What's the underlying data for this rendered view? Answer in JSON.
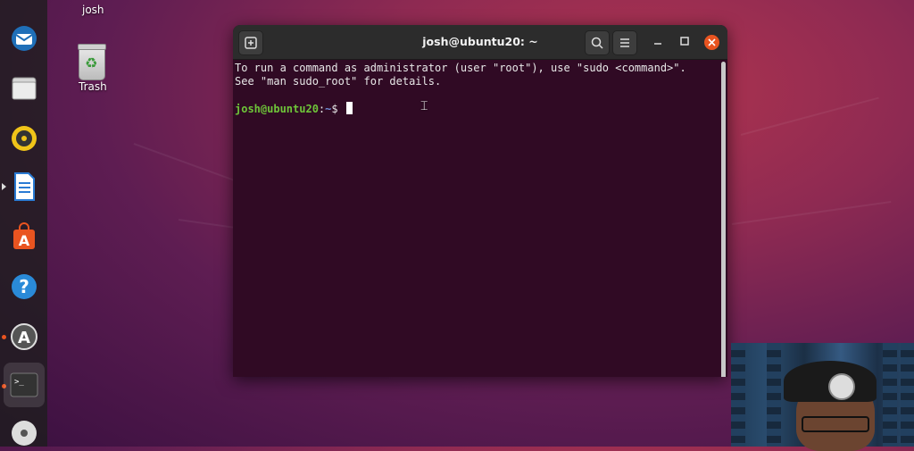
{
  "desktop": {
    "home_label": "josh",
    "trash_label": "Trash"
  },
  "dock": {
    "items": [
      {
        "name": "thunderbird",
        "icon": "mail-icon",
        "color": "#1f6fb8"
      },
      {
        "name": "files",
        "icon": "folder-icon",
        "color": "#cfcfcf"
      },
      {
        "name": "rhythmbox",
        "icon": "speaker-icon",
        "color": "#f0c419"
      },
      {
        "name": "libreoffice-writer",
        "icon": "document-icon",
        "color": "#2a7bd4"
      },
      {
        "name": "ubuntu-software",
        "icon": "shopping-bag-icon",
        "color": "#e95420"
      },
      {
        "name": "help",
        "icon": "help-icon",
        "color": "#2a8ad8"
      },
      {
        "name": "software-updater",
        "icon": "update-icon",
        "color": "#9a9a9a"
      },
      {
        "name": "terminal",
        "icon": "terminal-icon",
        "color": "#333333"
      },
      {
        "name": "dvd",
        "icon": "disc-icon",
        "color": "#dddddd"
      }
    ]
  },
  "terminal": {
    "title": "josh@ubuntu20: ~",
    "lines": [
      "To run a command as administrator (user \"root\"), use \"sudo <command>\".",
      "See \"man sudo_root\" for details."
    ],
    "prompt_user": "josh@ubuntu20",
    "prompt_sep": ":",
    "prompt_path": "~",
    "prompt_symbol": "$",
    "colors": {
      "background": "#300a24",
      "prompt_user": "#6ec539",
      "prompt_path": "#6f8fd8",
      "close": "#e95420"
    }
  }
}
